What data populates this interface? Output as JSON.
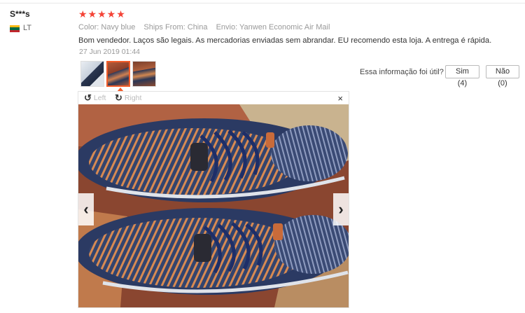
{
  "review": {
    "user_name": "S***s",
    "country_code": "LT",
    "stars": "★★★★★",
    "color_key": "Color:",
    "color_value": "Navy blue",
    "ships_key": "Ships From:",
    "ships_value": "China",
    "shipping_key": "Envio:",
    "shipping_value": "Yanwen Economic Air Mail",
    "text": "Bom vendedor. Laços são legais. As mercadorias enviadas sem abrandar. EU recomendo esta loja. A entrega é rápida.",
    "date": "27 Jun 2019 01:44"
  },
  "feedback": {
    "question": "Essa informação foi útil?",
    "yes_label": "Sim (4)",
    "no_label": "Não (0)"
  },
  "viewer": {
    "rotate_left_label": "Left",
    "rotate_right_label": "Right",
    "close_glyph": "×",
    "prev_glyph": "‹",
    "next_glyph": "›"
  },
  "colors": {
    "star": "#f44336",
    "accent": "#f25c2a",
    "flag": [
      "#fdb913",
      "#006a44",
      "#c1272d"
    ]
  },
  "icons": [
    "rotate-left-icon",
    "rotate-right-icon",
    "close-icon",
    "chevron-left-icon",
    "chevron-right-icon",
    "flag-lt-icon"
  ]
}
